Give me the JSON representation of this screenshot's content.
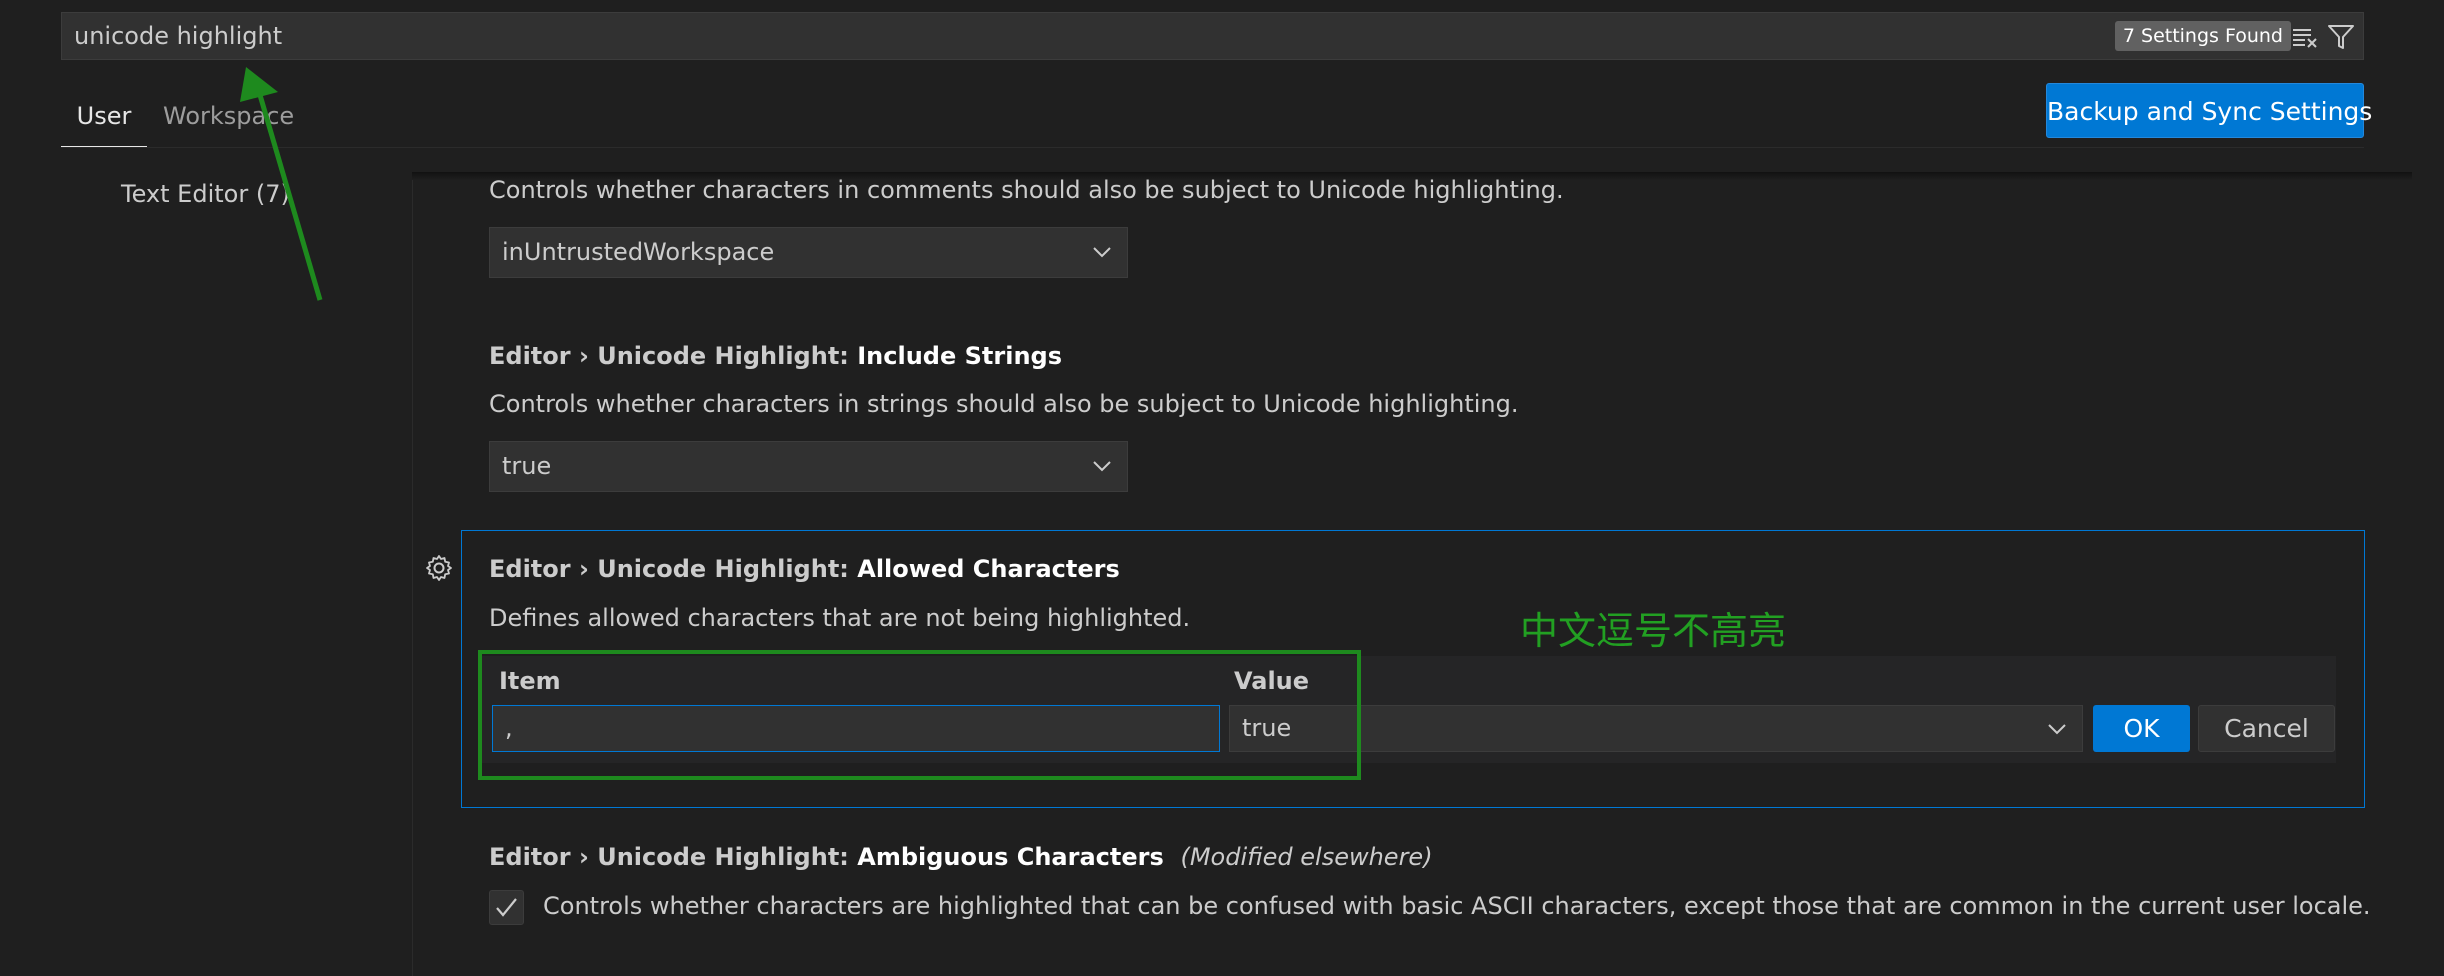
{
  "search": {
    "query": "unicode highlight",
    "results_badge": "7 Settings Found",
    "clear_icon": "clear-filter-icon",
    "filter_icon": "filter-icon"
  },
  "tabs": [
    {
      "label": "User",
      "active": true
    },
    {
      "label": "Workspace",
      "active": false
    }
  ],
  "sync_button": "Backup and Sync Settings",
  "toc": {
    "items": [
      {
        "label": "Text Editor (7)"
      }
    ]
  },
  "settings": {
    "include_comments": {
      "description": "Controls whether characters in comments should also be subject to Unicode highlighting.",
      "value": "inUntrustedWorkspace"
    },
    "include_strings": {
      "prefix": "Editor › Unicode Highlight: ",
      "name": "Include Strings",
      "description": "Controls whether characters in strings should also be subject to Unicode highlighting.",
      "value": "true"
    },
    "allowed_characters": {
      "prefix": "Editor › Unicode Highlight: ",
      "name": "Allowed Characters",
      "description": "Defines allowed characters that are not being highlighted.",
      "item_header": "Item",
      "value_header": "Value",
      "item_value": ",",
      "value_value": "true",
      "ok_label": "OK",
      "cancel_label": "Cancel"
    },
    "ambiguous_characters": {
      "prefix": "Editor › Unicode Highlight: ",
      "name": "Ambiguous Characters",
      "modified": "(Modified elsewhere)",
      "description": "Controls whether characters are highlighted that can be confused with basic ASCII characters, except those that are common in the current user locale.",
      "checked": true
    }
  },
  "annotation": {
    "text": "中文逗号不高亮",
    "color": "#22a022"
  },
  "colors": {
    "accent": "#0078d4",
    "background": "#1f1f1f",
    "annotation_green": "#1e8a1e"
  }
}
